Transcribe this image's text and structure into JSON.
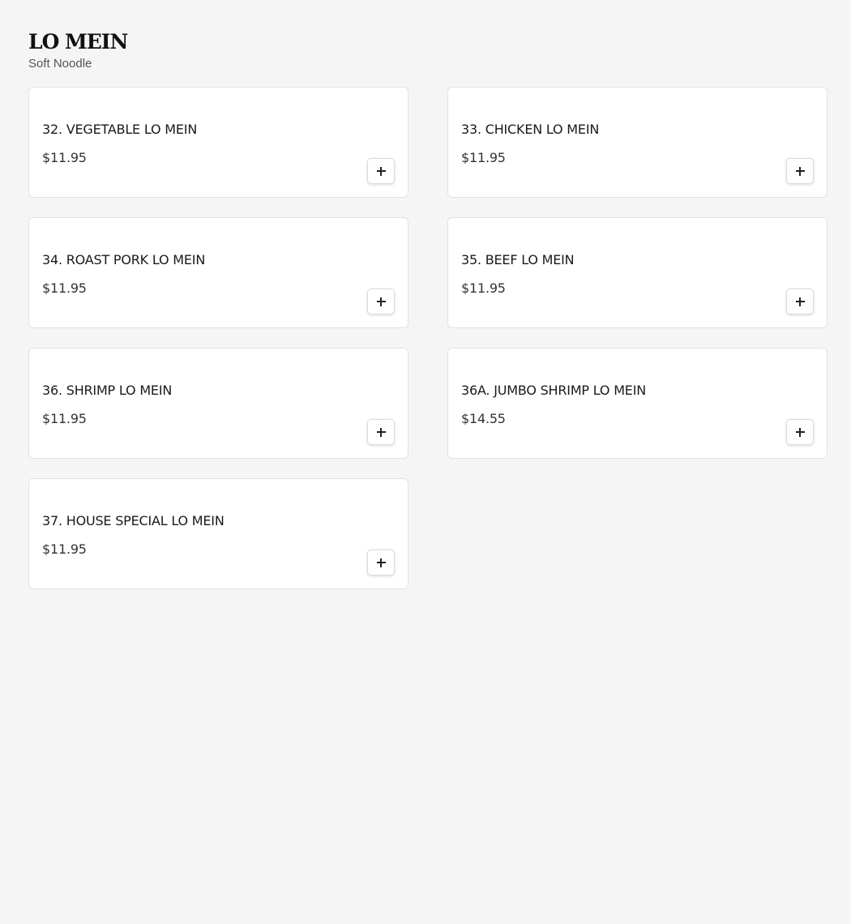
{
  "section": {
    "title": "LO MEIN",
    "subtitle": "Soft Noodle"
  },
  "items": [
    {
      "name": "32. VEGETABLE LO MEIN",
      "price": "$11.95",
      "add_icon": "plus-icon"
    },
    {
      "name": "33. CHICKEN LO MEIN",
      "price": "$11.95",
      "add_icon": "plus-icon"
    },
    {
      "name": "34. ROAST PORK LO MEIN",
      "price": "$11.95",
      "add_icon": "plus-icon"
    },
    {
      "name": "35. BEEF LO MEIN",
      "price": "$11.95",
      "add_icon": "plus-icon"
    },
    {
      "name": "36. SHRIMP LO MEIN",
      "price": "$11.95",
      "add_icon": "plus-icon"
    },
    {
      "name": "36A. JUMBO SHRIMP LO MEIN",
      "price": "$14.55",
      "add_icon": "plus-icon"
    },
    {
      "name": "37. HOUSE SPECIAL LO MEIN",
      "price": "$11.95",
      "add_icon": "plus-icon"
    }
  ],
  "colors": {
    "background": "#f5f5f5",
    "card": "#ffffff",
    "border": "#e2e2e2",
    "text": "#1a1a1a"
  }
}
